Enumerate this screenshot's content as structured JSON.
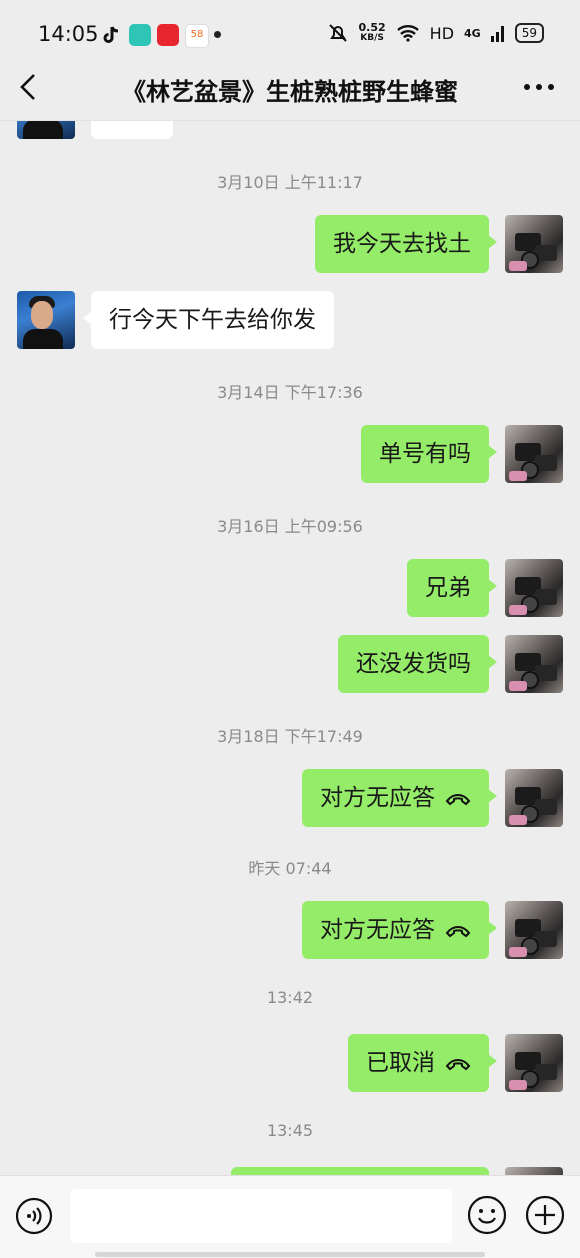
{
  "status_bar": {
    "time": "14:05",
    "app_58": "58",
    "net_speed_value": "0.52",
    "net_speed_unit": "KB/S",
    "hd": "HD",
    "signal": "4G",
    "battery": "59"
  },
  "header": {
    "title": "《林艺盆景》生桩熟桩野生蜂蜜"
  },
  "messages": [
    {
      "type": "time",
      "text": "3月10日 上午11:17"
    },
    {
      "type": "self",
      "text": "我今天去找土"
    },
    {
      "type": "other",
      "text": "行今天下午去给你发"
    },
    {
      "type": "time",
      "text": "3月14日 下午17:36"
    },
    {
      "type": "self",
      "text": "单号有吗"
    },
    {
      "type": "time",
      "text": "3月16日 上午09:56"
    },
    {
      "type": "self",
      "text": "兄弟"
    },
    {
      "type": "self",
      "text": "还没发货吗"
    },
    {
      "type": "time",
      "text": "3月18日 下午17:49"
    },
    {
      "type": "self",
      "text": "对方无应答",
      "icon": "hangup-phone-icon"
    },
    {
      "type": "time",
      "text": "昨天 07:44"
    },
    {
      "type": "self",
      "text": "对方无应答",
      "icon": "hangup-phone-icon"
    },
    {
      "type": "time",
      "text": "13:42"
    },
    {
      "type": "self",
      "text": "已取消",
      "icon": "hangup-phone-icon"
    },
    {
      "type": "time",
      "text": "13:45"
    }
  ],
  "input_bar": {
    "placeholder": "",
    "voice_icon": "voice-icon",
    "emoji_icon": "emoji-icon",
    "plus_icon": "plus-icon"
  },
  "colors": {
    "self_bubble": "#95ec69",
    "other_bubble": "#ffffff",
    "background": "#ededed"
  }
}
